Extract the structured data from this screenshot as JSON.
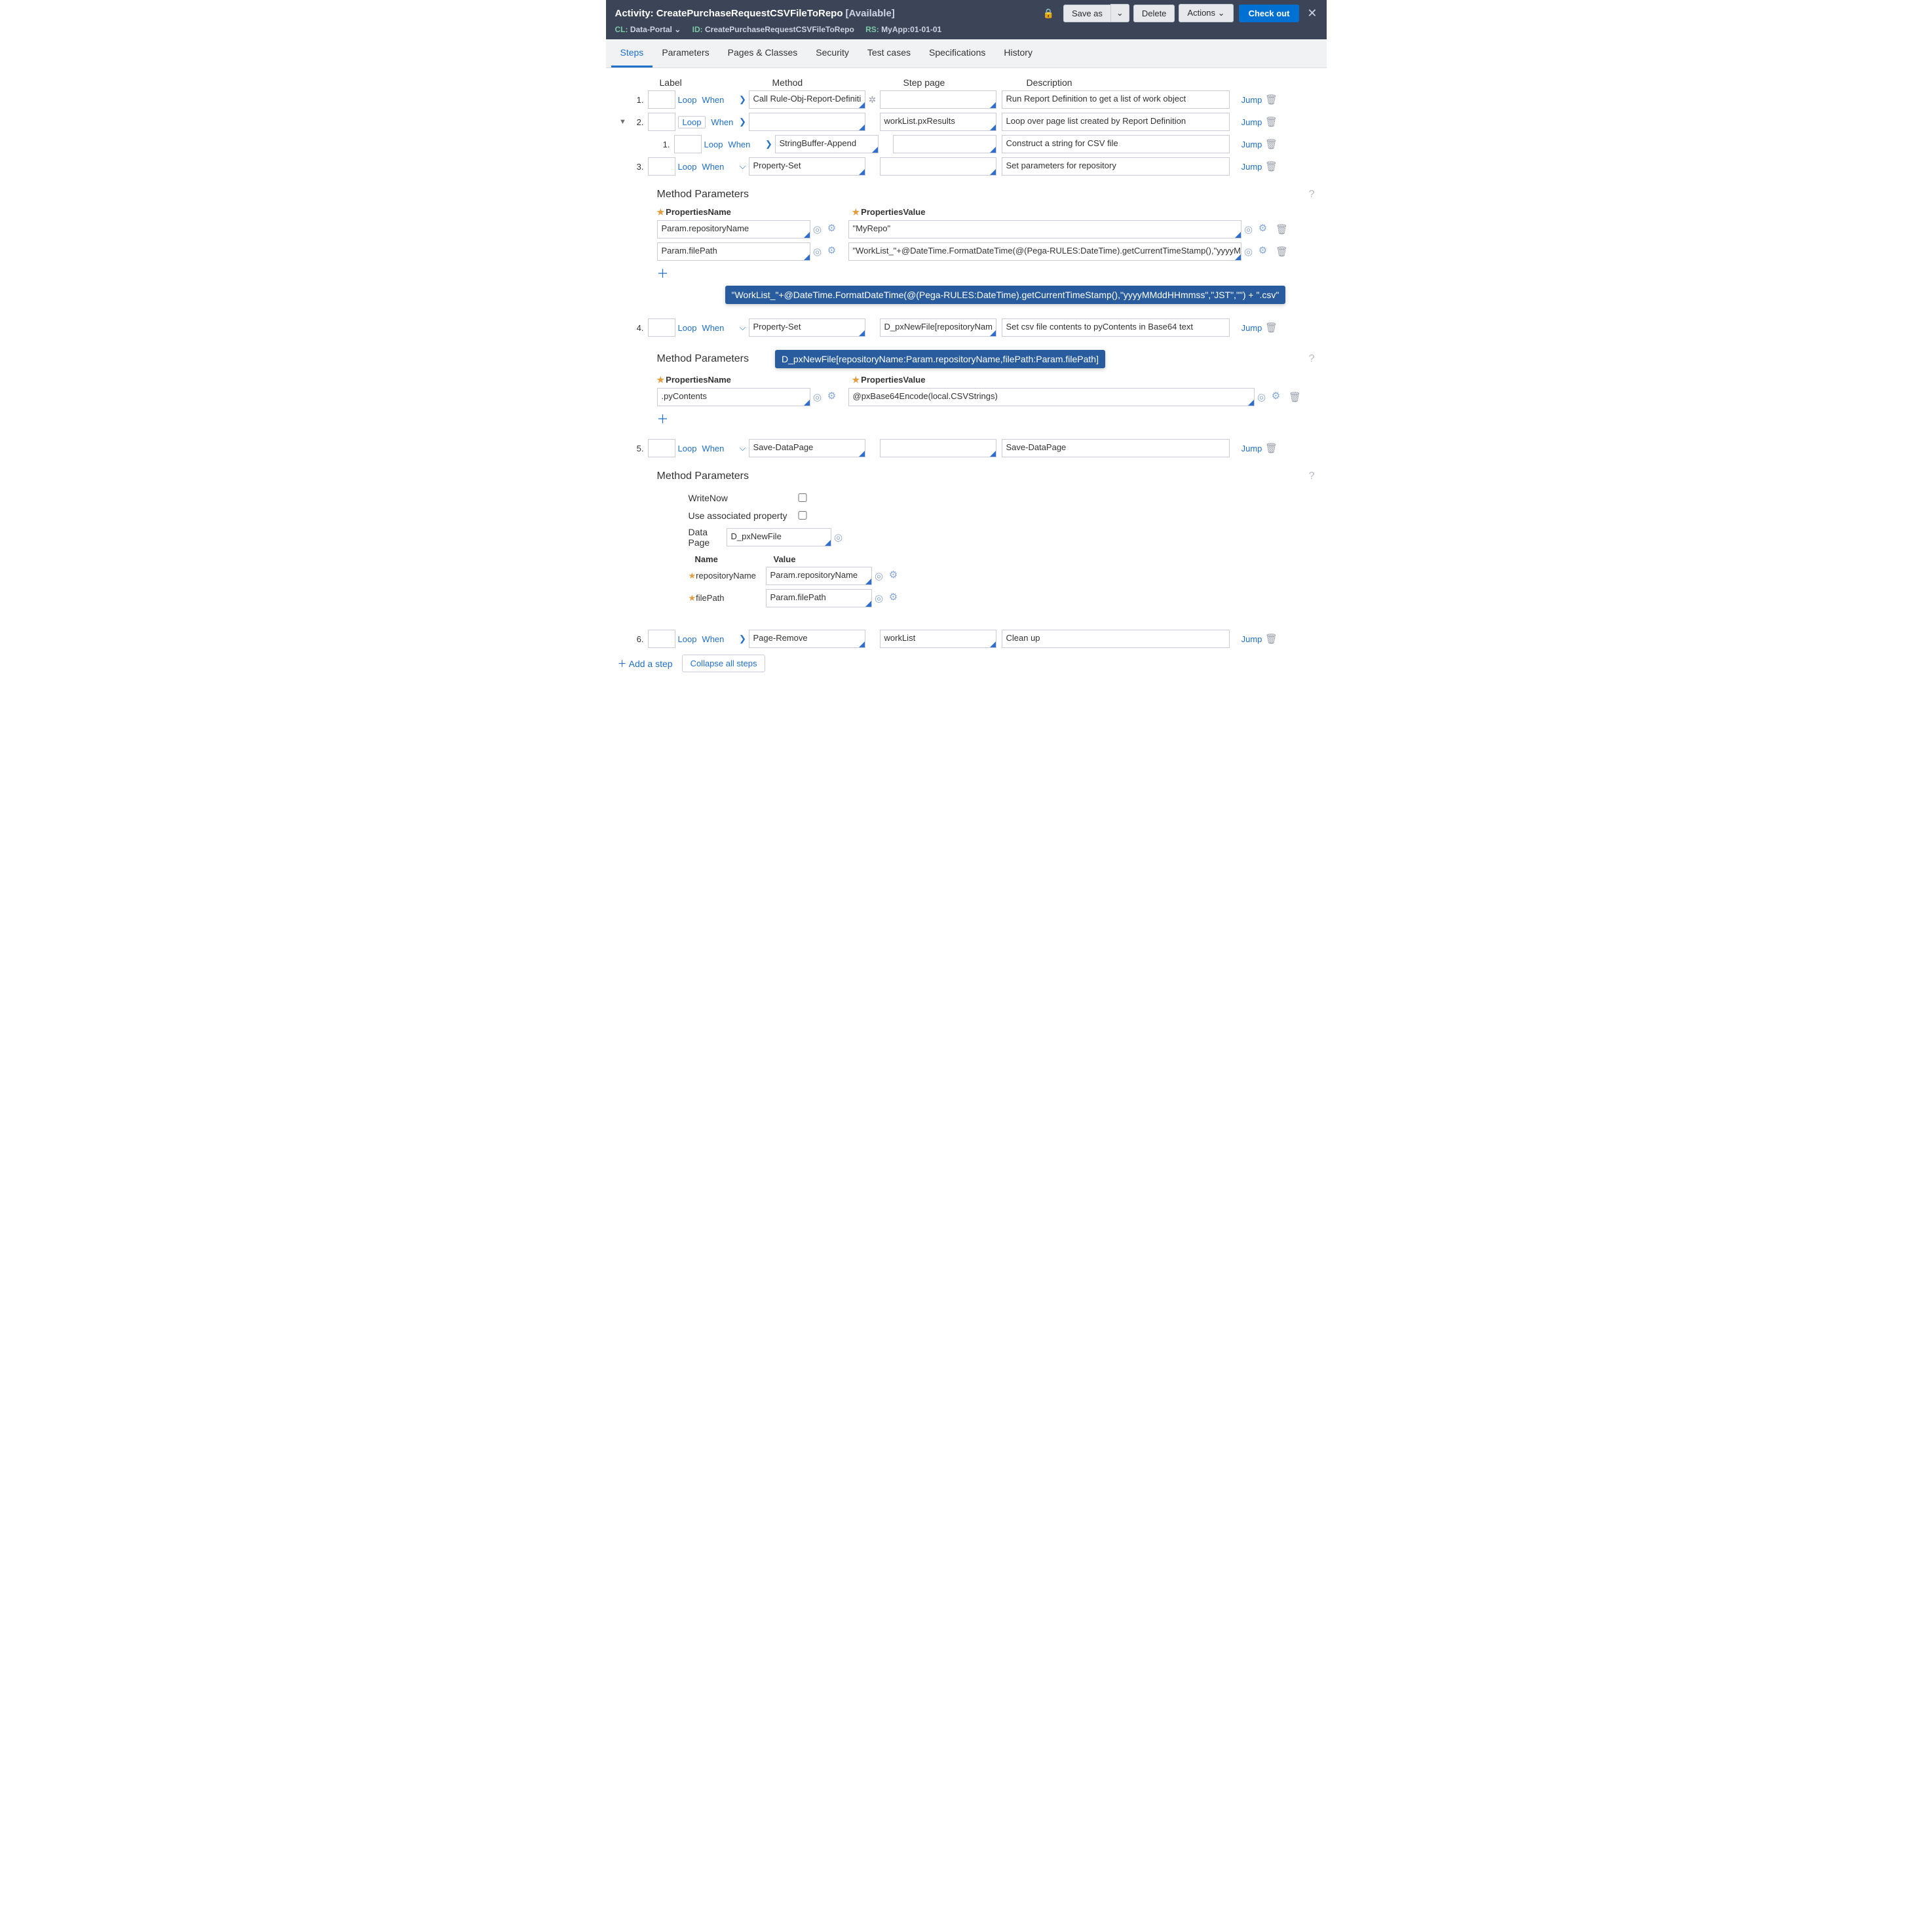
{
  "header": {
    "type_label": "Activity:",
    "rule_name": "CreatePurchaseRequestCSVFileToRepo",
    "status": "[Available]",
    "meta": {
      "cl_key": "CL:",
      "cl_val": "Data-Portal",
      "id_key": "ID:",
      "id_val": "CreatePurchaseRequestCSVFileToRepo",
      "rs_key": "RS:",
      "rs_val": "MyApp:01-01-01"
    },
    "buttons": {
      "save_as": "Save as",
      "delete": "Delete",
      "actions": "Actions",
      "checkout": "Check out"
    }
  },
  "tabs": [
    "Steps",
    "Parameters",
    "Pages & Classes",
    "Security",
    "Test cases",
    "Specifications",
    "History"
  ],
  "active_tab": "Steps",
  "columns": {
    "label": "Label",
    "method": "Method",
    "step_page": "Step page",
    "description": "Description"
  },
  "links": {
    "loop": "Loop",
    "when": "When",
    "jump": "Jump",
    "add_step": "Add a step",
    "collapse": "Collapse all steps"
  },
  "steps": [
    {
      "num": "1.",
      "label": "",
      "loop_boxed": false,
      "chev": ">",
      "method": "Call Rule-Obj-Report-Definiti",
      "step_page": "",
      "description": "Run Report Definition to get a list of work object"
    },
    {
      "num": "2.",
      "label": "",
      "loop_boxed": true,
      "chev": ">",
      "method": "",
      "step_page": "workList.pxResults",
      "description": "Loop over page list created by Report Definition",
      "expanded": true,
      "children": [
        {
          "num": "1.",
          "label": "",
          "chev": ">",
          "method": "StringBuffer-Append",
          "step_page": "",
          "description": "Construct a string for CSV file"
        }
      ]
    },
    {
      "num": "3.",
      "label": "",
      "chev": "v",
      "method": "Property-Set",
      "step_page": "",
      "description": "Set parameters for repository"
    }
  ],
  "mp3": {
    "title": "Method Parameters",
    "prop_name_label": "PropertiesName",
    "prop_val_label": "PropertiesValue",
    "rows": [
      {
        "name": "Param.repositoryName",
        "value": "\"MyRepo\""
      },
      {
        "name": "Param.filePath",
        "value": "\"WorkList_\"+@DateTime.FormatDateTime(@(Pega-RULES:DateTime).getCurrentTimeStamp(),\"yyyyM"
      }
    ],
    "tooltip": "\"WorkList_\"+@DateTime.FormatDateTime(@(Pega-RULES:DateTime).getCurrentTimeStamp(),\"yyyyMMddHHmmss\",\"JST\",\"\") + \".csv\""
  },
  "step4": {
    "num": "4.",
    "label": "",
    "chev": "v",
    "method": "Property-Set",
    "step_page": "D_pxNewFile[repositoryNam",
    "description": "Set csv file contents to pyContents in Base64 text",
    "page_tooltip": "D_pxNewFile[repositoryName:Param.repositoryName,filePath:Param.filePath]"
  },
  "mp4": {
    "title": "Method Parameters",
    "prop_name_label": "PropertiesName",
    "prop_val_label": "PropertiesValue",
    "rows": [
      {
        "name": ".pyContents",
        "value": "@pxBase64Encode(local.CSVStrings)"
      }
    ]
  },
  "step5": {
    "num": "5.",
    "label": "",
    "chev": "v",
    "method": "Save-DataPage",
    "step_page": "",
    "description": "Save-DataPage"
  },
  "mp5": {
    "title": "Method Parameters",
    "writenow_label": "WriteNow",
    "useassoc_label": "Use associated property",
    "datapage_label": "Data Page",
    "datapage_value": "D_pxNewFile",
    "name_head": "Name",
    "value_head": "Value",
    "params": [
      {
        "name": "repositoryName",
        "value": "Param.repositoryName"
      },
      {
        "name": "filePath",
        "value": "Param.filePath"
      }
    ]
  },
  "step6": {
    "num": "6.",
    "label": "",
    "chev": ">",
    "method": "Page-Remove",
    "step_page": "workList",
    "description": "Clean up"
  }
}
